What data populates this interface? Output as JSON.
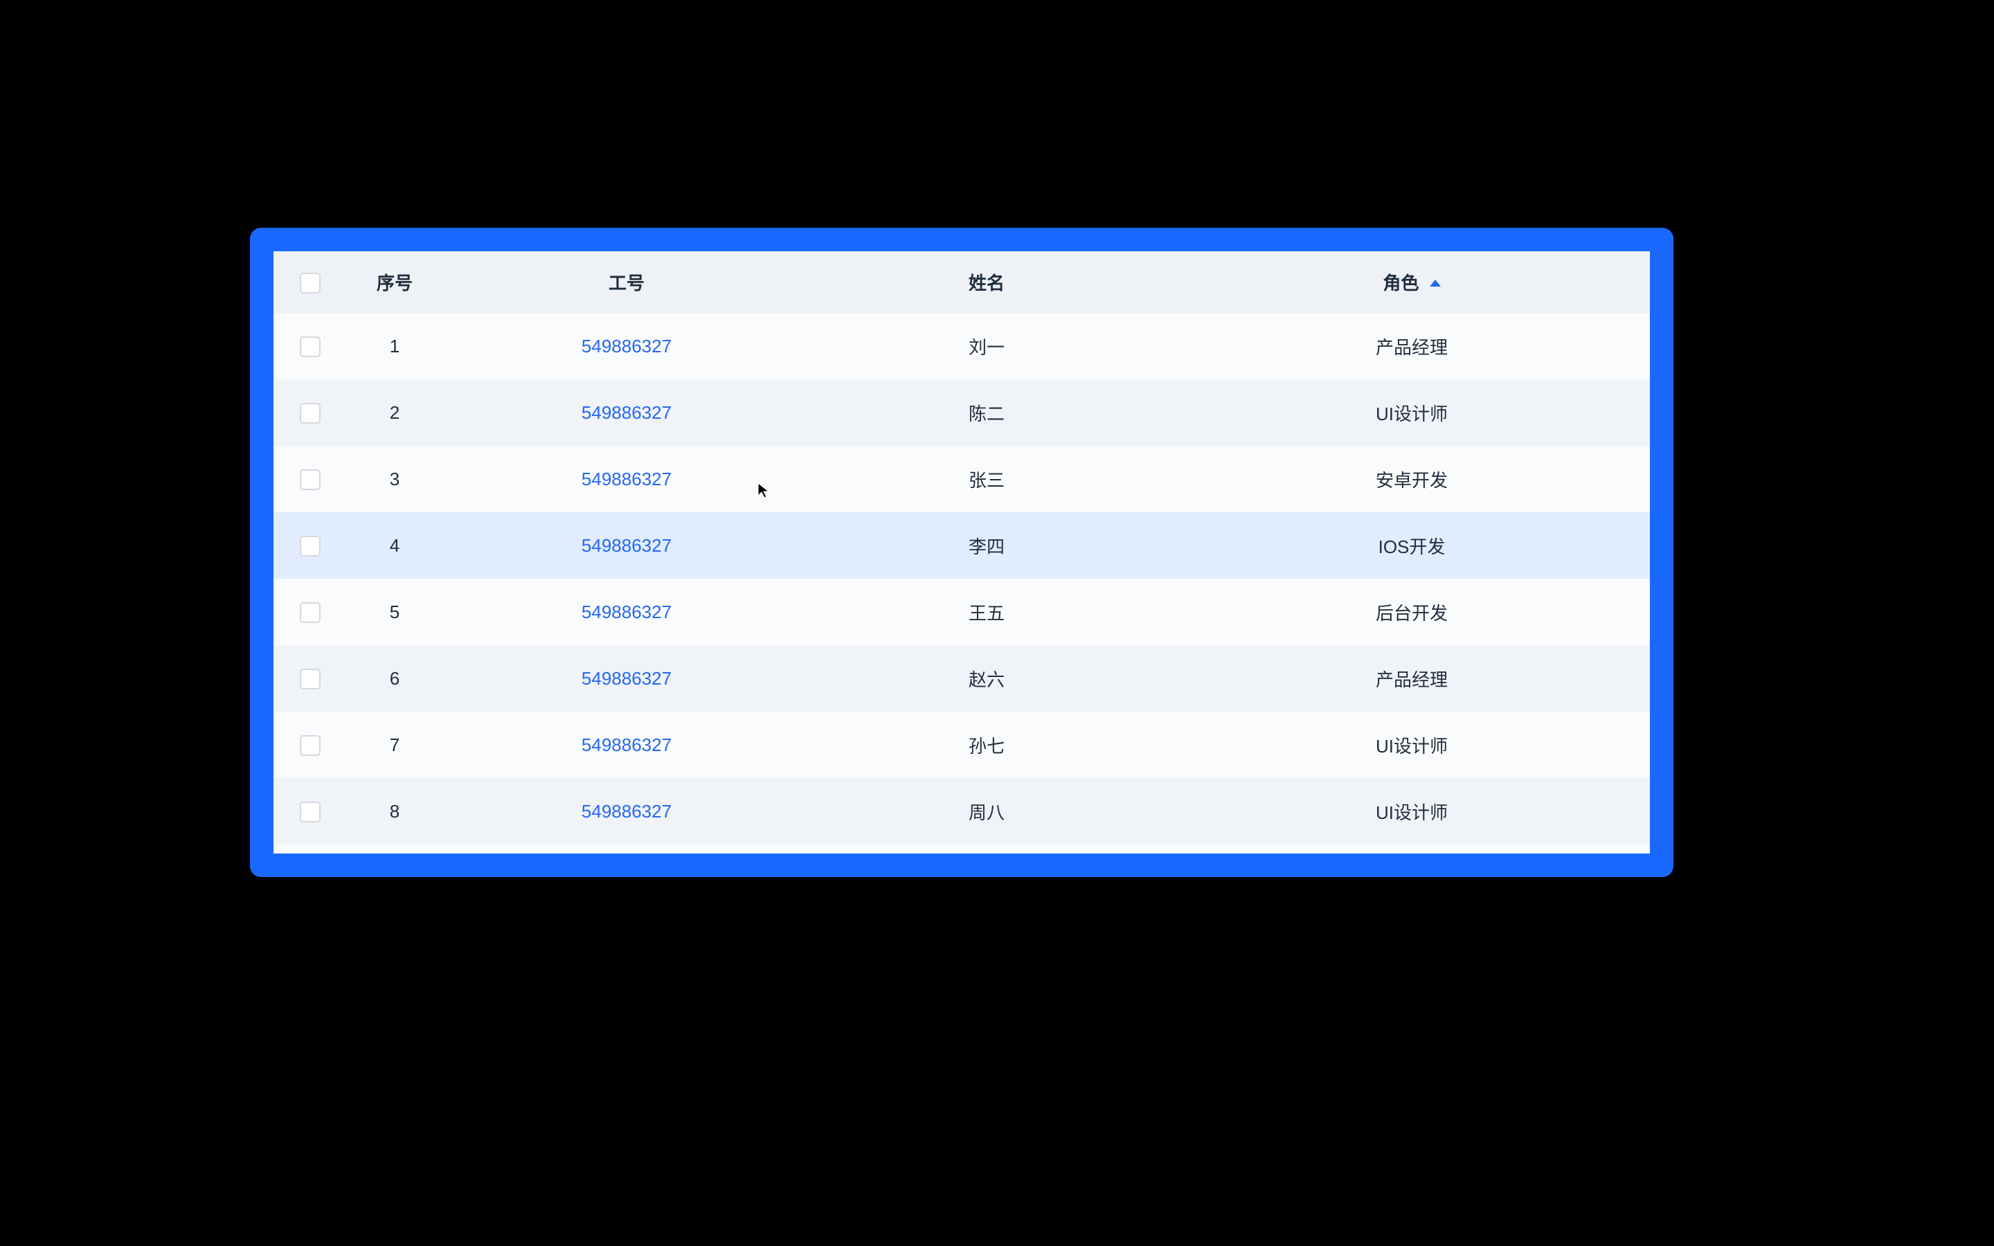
{
  "columns": {
    "seq": "序号",
    "id": "工号",
    "name": "姓名",
    "role": "角色"
  },
  "sort": {
    "column": "角色",
    "direction": "asc"
  },
  "rows": [
    {
      "seq": "1",
      "id": "549886327",
      "name": "刘一",
      "role": "产品经理"
    },
    {
      "seq": "2",
      "id": "549886327",
      "name": "陈二",
      "role": "UI设计师"
    },
    {
      "seq": "3",
      "id": "549886327",
      "name": "张三",
      "role": "安卓开发"
    },
    {
      "seq": "4",
      "id": "549886327",
      "name": "李四",
      "role": "IOS开发"
    },
    {
      "seq": "5",
      "id": "549886327",
      "name": "王五",
      "role": "后台开发"
    },
    {
      "seq": "6",
      "id": "549886327",
      "name": "赵六",
      "role": "产品经理"
    },
    {
      "seq": "7",
      "id": "549886327",
      "name": "孙七",
      "role": "UI设计师"
    },
    {
      "seq": "8",
      "id": "549886327",
      "name": "周八",
      "role": "UI设计师"
    }
  ],
  "hover_row_index": 3,
  "colors": {
    "frame": "#1969ff",
    "link": "#2468f2",
    "header_bg": "#eef1f6",
    "row_odd": "#fafbfc",
    "row_even": "#f0f3f8",
    "row_hover": "#e1ecfe"
  }
}
